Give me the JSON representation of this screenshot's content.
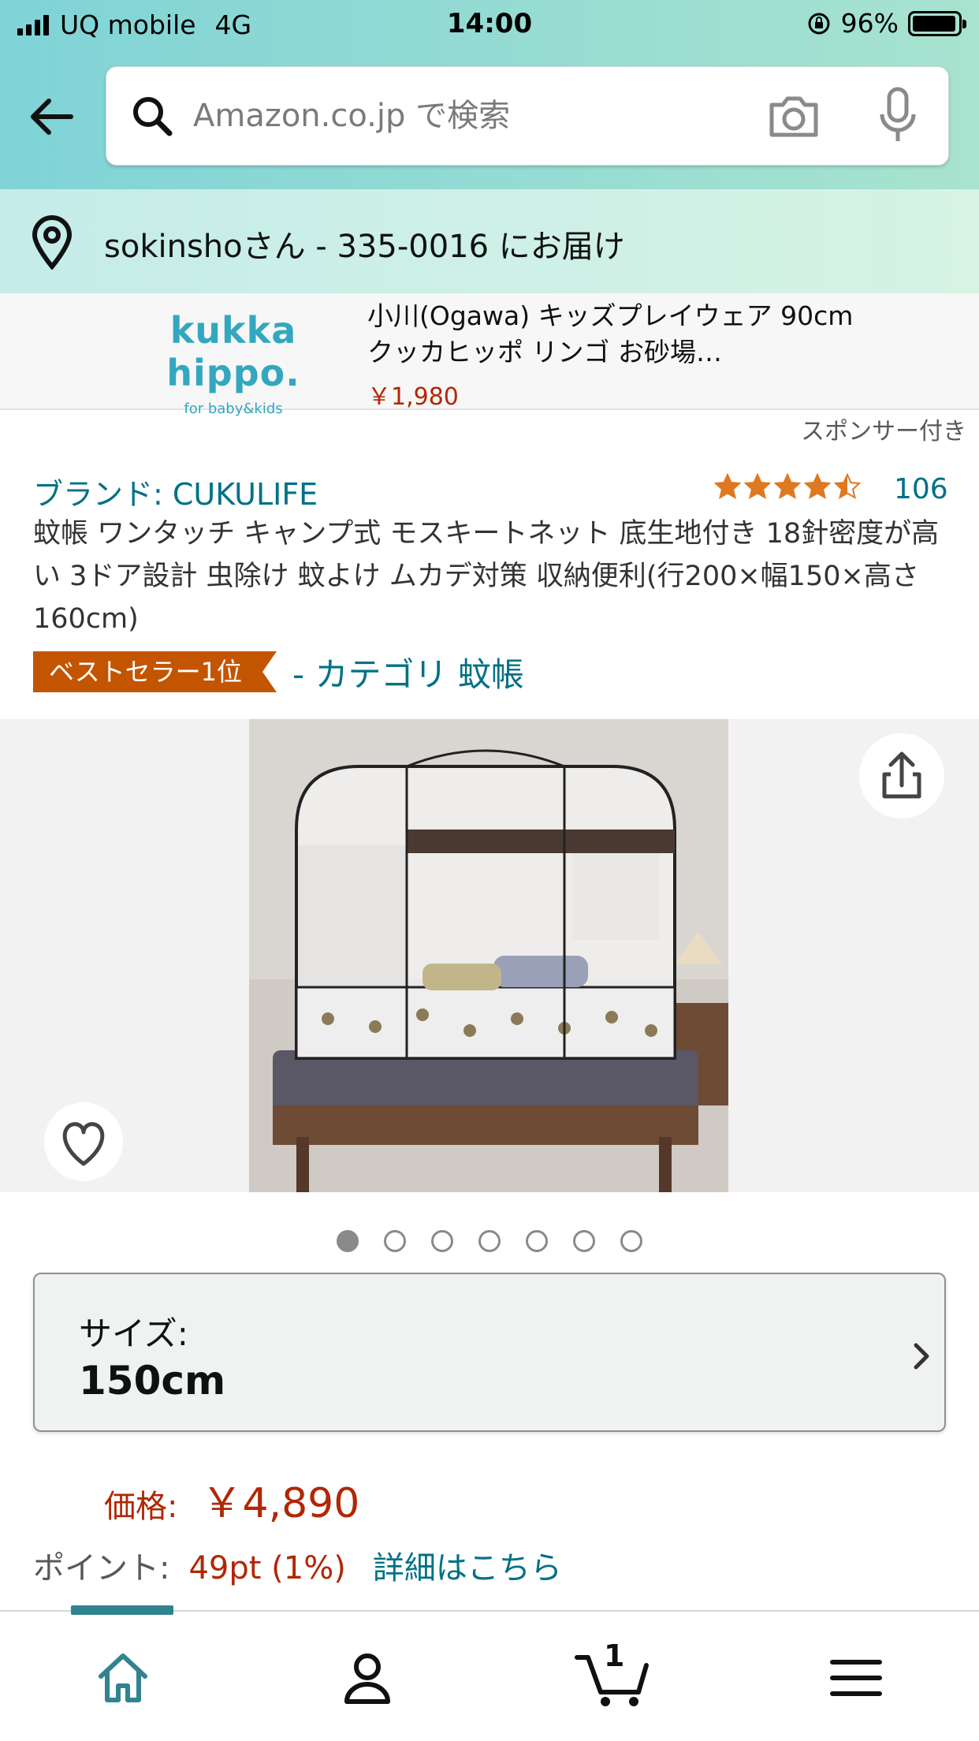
{
  "status_bar": {
    "carrier": "UQ mobile",
    "network": "4G",
    "time": "14:00",
    "battery_percent": "96%",
    "battery_level": 0.96
  },
  "search": {
    "placeholder": "Amazon.co.jp で検索",
    "icons": [
      "search-icon",
      "camera-icon",
      "mic-icon"
    ]
  },
  "delivery": {
    "text": "sokinshoさん -  335-0016 にお届け"
  },
  "sponsored_ad": {
    "logo_name": "kukka hippo.",
    "logo_sub": "for baby&kids",
    "title": "小川(Ogawa) キッズプレイウェア 90cm クッカヒッポ リンゴ お砂場…",
    "price": "￥1,980",
    "sponsored_label": "スポンサー付き"
  },
  "product": {
    "brand": "ブランド: CUKULIFE",
    "rating_stars": 4.5,
    "rating_count": "106",
    "title": "蚊帳 ワンタッチ キャンプ式 モスキートネット 底生地付き 18針密度が高い 3ドア設計 虫除け 蚊よけ ムカデ対策 収納便利(行200×幅150×高さ160cm)",
    "bestseller_badge": "ベストセラー1位",
    "category_link": "- カテゴリ 蚊帳"
  },
  "gallery": {
    "image_count": 7,
    "active_index": 0
  },
  "size": {
    "label": "サイズ:",
    "value": "150cm"
  },
  "price": {
    "label": "価格:",
    "value": "￥4,890"
  },
  "points": {
    "label": "ポイント:",
    "value": "49pt  (1%)",
    "link": "詳細はこちら"
  },
  "bottom_nav": {
    "items": [
      "home-icon",
      "account-icon",
      "cart-icon",
      "menu-icon"
    ],
    "cart_count": "1",
    "active": "home"
  },
  "colors": {
    "accent_teal": "#007185",
    "price_red": "#b12704",
    "badge_orange": "#c45500",
    "nav_active": "#31848f"
  }
}
